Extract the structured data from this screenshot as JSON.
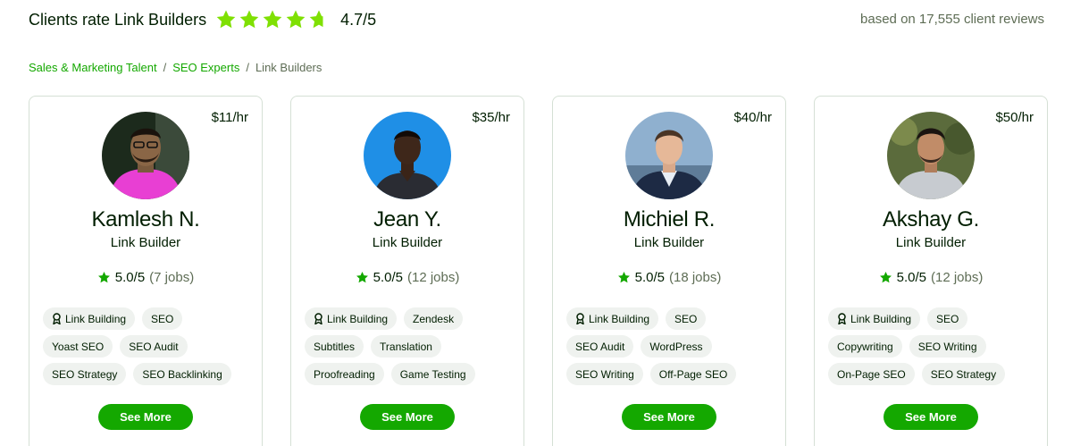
{
  "header": {
    "title": "Clients rate Link Builders",
    "rating": "4.7/5",
    "stars_value": 4.7,
    "reviews": "based on 17,555 client reviews"
  },
  "breadcrumb": {
    "items": [
      "Sales & Marketing Talent",
      "SEO Experts"
    ],
    "separator": "/",
    "current": "Link Builders"
  },
  "colors": {
    "accent": "#14a800",
    "star": "#7fe003",
    "text": "#001e00",
    "muted": "#5e6d55",
    "chip_bg": "#eff2ef"
  },
  "icons": {
    "header_star": "star-icon",
    "rating_star": "star-icon",
    "skill_badge": "award-badge-icon"
  },
  "cards": [
    {
      "rate": "$11/hr",
      "name": "Kamlesh N.",
      "title": "Link Builder",
      "score": "5.0/5",
      "jobs": "(7 jobs)",
      "skills": [
        "Link Building",
        "SEO",
        "Yoast SEO",
        "SEO Audit",
        "SEO Strategy",
        "SEO Backlinking"
      ],
      "button": "See More"
    },
    {
      "rate": "$35/hr",
      "name": "Jean Y.",
      "title": "Link Builder",
      "score": "5.0/5",
      "jobs": "(12 jobs)",
      "skills": [
        "Link Building",
        "Zendesk",
        "Subtitles",
        "Translation",
        "Proofreading",
        "Game Testing"
      ],
      "button": "See More"
    },
    {
      "rate": "$40/hr",
      "name": "Michiel R.",
      "title": "Link Builder",
      "score": "5.0/5",
      "jobs": "(18 jobs)",
      "skills": [
        "Link Building",
        "SEO",
        "SEO Audit",
        "WordPress",
        "SEO Writing",
        "Off-Page SEO"
      ],
      "button": "See More"
    },
    {
      "rate": "$50/hr",
      "name": "Akshay G.",
      "title": "Link Builder",
      "score": "5.0/5",
      "jobs": "(12 jobs)",
      "skills": [
        "Link Building",
        "SEO",
        "Copywriting",
        "SEO Writing",
        "On-Page SEO",
        "SEO Strategy"
      ],
      "button": "See More"
    }
  ]
}
